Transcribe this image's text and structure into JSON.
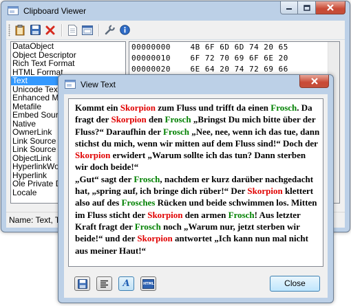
{
  "main_window": {
    "title": "Clipboard Viewer",
    "toolbar_icons": [
      "clipboard-icon",
      "save-icon",
      "delete-icon",
      "document-icon",
      "window-icon",
      "wrench-icon",
      "info-icon"
    ],
    "formats": [
      "DataObject",
      "Object Descriptor",
      "Rich Text Format",
      "HTML Format",
      "Text",
      "Unicode Text",
      "Enhanced M",
      "Metafile",
      "Embed Sourc",
      "Native",
      "OwnerLink",
      "Link Source",
      "Link Source",
      "ObjectLink",
      "HyperlinkWo",
      "Hyperlink",
      "Ole Private D",
      "Locale"
    ],
    "selected_format": "Text",
    "hex_rows": [
      "00000000    4B 6F 6D 6D 74 20 65",
      "00000010    6F 72 70 69 6F 6E 20",
      "00000020    6E 64 20 74 72 69 66"
    ],
    "status": "Name: Text, T"
  },
  "view_dialog": {
    "title": "View Text",
    "text_segments": [
      [
        "Kommt ein ",
        "b"
      ],
      [
        "Skorpion",
        "r"
      ],
      [
        " zum Fluss und trifft da einen ",
        "b"
      ],
      [
        "Frosch",
        "g"
      ],
      [
        ". Da fragt der ",
        "b"
      ],
      [
        "Skorpion",
        "r"
      ],
      [
        " den ",
        "b"
      ],
      [
        "Frosch",
        "g"
      ],
      [
        " „Bringst Du mich bitte über der Fluss?“ Daraufhin der ",
        "b"
      ],
      [
        "Frosch",
        "g"
      ],
      [
        " „Nee, nee, wenn ich das tue, dann stichst du mich, wenn wir mitten auf dem Fluss sind!“ Doch der ",
        "b"
      ],
      [
        "Skorpion",
        "r"
      ],
      [
        " erwidert „Warum sollte ich das tun? Dann sterben wir doch beide!“",
        "b"
      ],
      [
        "\n",
        "n"
      ],
      [
        "„Gut“ sagt der ",
        "b"
      ],
      [
        "Frosch",
        "g"
      ],
      [
        ", nachdem er kurz darüber nachgedacht hat, „spring auf, ich bringe dich rüber!“ Der ",
        "b"
      ],
      [
        "Skorpion",
        "r"
      ],
      [
        " klettert also auf des ",
        "b"
      ],
      [
        "Frosches",
        "g"
      ],
      [
        " Rücken und beide schwimmen los. Mitten im Fluss sticht der ",
        "b"
      ],
      [
        "Skorpion",
        "r"
      ],
      [
        " den armen ",
        "b"
      ],
      [
        "Frosch",
        "g"
      ],
      [
        "! Aus letzter Kraft fragt der ",
        "b"
      ],
      [
        "Frosch",
        "g"
      ],
      [
        " noch „Warum nur, jetzt sterben wir beide!“ und der ",
        "b"
      ],
      [
        "Skorpion",
        "r"
      ],
      [
        " antwortet „Ich kann nun mal nicht aus meiner Haut!“",
        "b"
      ]
    ],
    "bottom_icons": [
      "save-icon",
      "align-left-icon",
      "font-icon",
      "html-icon"
    ],
    "html_icon_label": "HTML",
    "font_icon_label": "A",
    "close_label": "Close"
  }
}
